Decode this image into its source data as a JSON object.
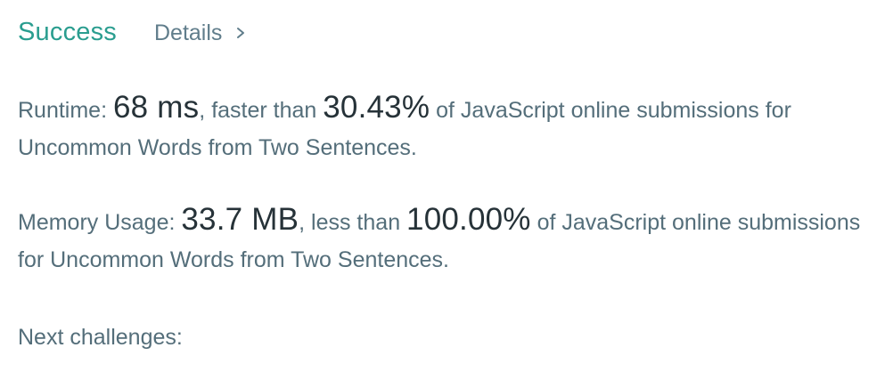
{
  "header": {
    "status": "Success",
    "details_label": "Details",
    "details_icon": "chevron-right-icon"
  },
  "runtime": {
    "label": "Runtime: ",
    "value": "68 ms",
    "connector": ", faster than ",
    "percent": "30.43%",
    "suffix": " of JavaScript online submissions for Uncommon Words from Two Sentences."
  },
  "memory": {
    "label": "Memory Usage: ",
    "value": "33.7 MB",
    "connector": ", less than ",
    "percent": "100.00%",
    "suffix": " of JavaScript online submissions for Uncommon Words from Two Sentences."
  },
  "next": {
    "label": "Next challenges:"
  },
  "colors": {
    "success": "#2a9d8f",
    "text": "#546e7a",
    "emphasis": "#263238"
  }
}
